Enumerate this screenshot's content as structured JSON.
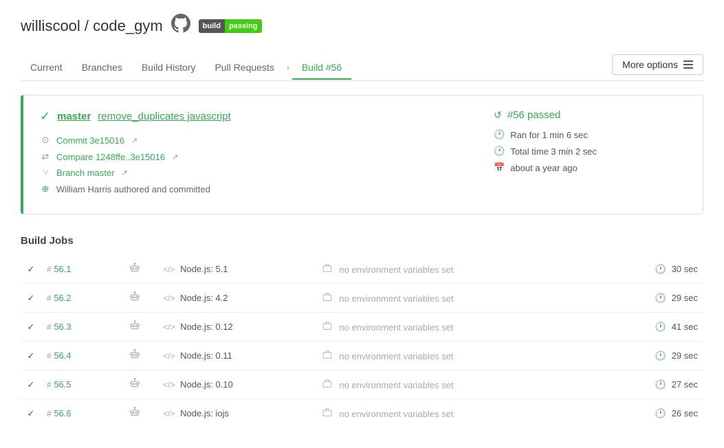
{
  "header": {
    "repo_owner": "williscool",
    "repo_sep": "/",
    "repo_name": "code_gym",
    "badge_build": "build",
    "badge_status": "passing"
  },
  "nav": {
    "tabs": [
      {
        "id": "current",
        "label": "Current",
        "active": false
      },
      {
        "id": "branches",
        "label": "Branches",
        "active": false
      },
      {
        "id": "build-history",
        "label": "Build History",
        "active": false
      },
      {
        "id": "pull-requests",
        "label": "Pull Requests",
        "active": false
      },
      {
        "id": "build-56",
        "label": "Build #56",
        "active": true
      }
    ],
    "more_options": "More options"
  },
  "build_info": {
    "branch": "master",
    "commit_msg": "remove_duplicates javascript",
    "build_number": "#56",
    "status": "passed",
    "commit_hash": "Commit 3e15016",
    "compare": "Compare 1248ffe..3e15016",
    "branch_label": "Branch master",
    "author": "William Harris authored and committed",
    "ran_for": "Ran for 1 min 6 sec",
    "total_time": "Total time 3 min 2 sec",
    "timestamp": "about a year ago"
  },
  "build_jobs": {
    "section_title": "Build Jobs",
    "jobs": [
      {
        "id": "56.1",
        "node": "Node.js: 5.1",
        "env": "no environment variables set",
        "time": "30 sec"
      },
      {
        "id": "56.2",
        "node": "Node.js: 4.2",
        "env": "no environment variables set",
        "time": "29 sec"
      },
      {
        "id": "56.3",
        "node": "Node.js: 0.12",
        "env": "no environment variables set",
        "time": "41 sec"
      },
      {
        "id": "56.4",
        "node": "Node.js: 0.11",
        "env": "no environment variables set",
        "time": "29 sec"
      },
      {
        "id": "56.5",
        "node": "Node.js: 0.10",
        "env": "no environment variables set",
        "time": "27 sec"
      },
      {
        "id": "56.6",
        "node": "Node.js: iojs",
        "env": "no environment variables set",
        "time": "26 sec"
      }
    ]
  }
}
